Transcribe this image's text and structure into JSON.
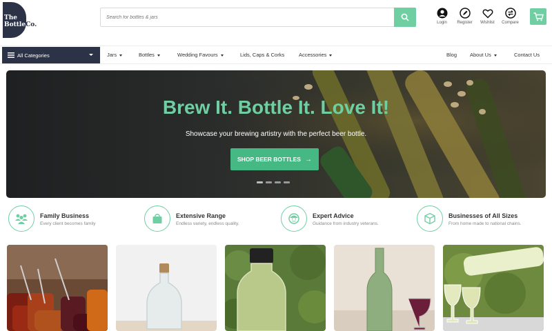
{
  "logo": {
    "line1": "The",
    "line2a": "Bottle",
    "line2b": "Co."
  },
  "search": {
    "placeholder": "Search for bottles & jars"
  },
  "header_icons": [
    {
      "label": "Login",
      "icon": "user-icon"
    },
    {
      "label": "Register",
      "icon": "pen-icon"
    },
    {
      "label": "Wishlist",
      "icon": "heart-icon"
    },
    {
      "label": "Compare",
      "icon": "compare-icon"
    }
  ],
  "nav": {
    "all_categories": "All Categories",
    "items": [
      "Jars",
      "Bottles",
      "Wedding Favours",
      "Lids, Caps & Corks",
      "Accessories"
    ],
    "right_items": [
      "Blog",
      "About Us",
      "Contact Us"
    ]
  },
  "hero": {
    "title": "Brew It. Bottle It. Love It!",
    "subtitle": "Showcase your brewing artistry with the perfect beer bottle.",
    "button_label": "SHOP BEER BOTTLES",
    "slide_count": 4,
    "active_slide": 1
  },
  "features": [
    {
      "title": "Family Business",
      "subtitle": "Every client becomes family",
      "icon": "family-icon"
    },
    {
      "title": "Extensive Range",
      "subtitle": "Endless variety, endless quality.",
      "icon": "shopping-bag-icon"
    },
    {
      "title": "Expert Advice",
      "subtitle": "Guidance from industry veterans.",
      "icon": "expert-icon"
    },
    {
      "title": "Businesses of All Sizes",
      "subtitle": "From home made to national chains.",
      "icon": "box-icon"
    }
  ],
  "colors": {
    "accent": "#6fcfa3",
    "button": "#45b883",
    "navy": "#2d3347"
  }
}
